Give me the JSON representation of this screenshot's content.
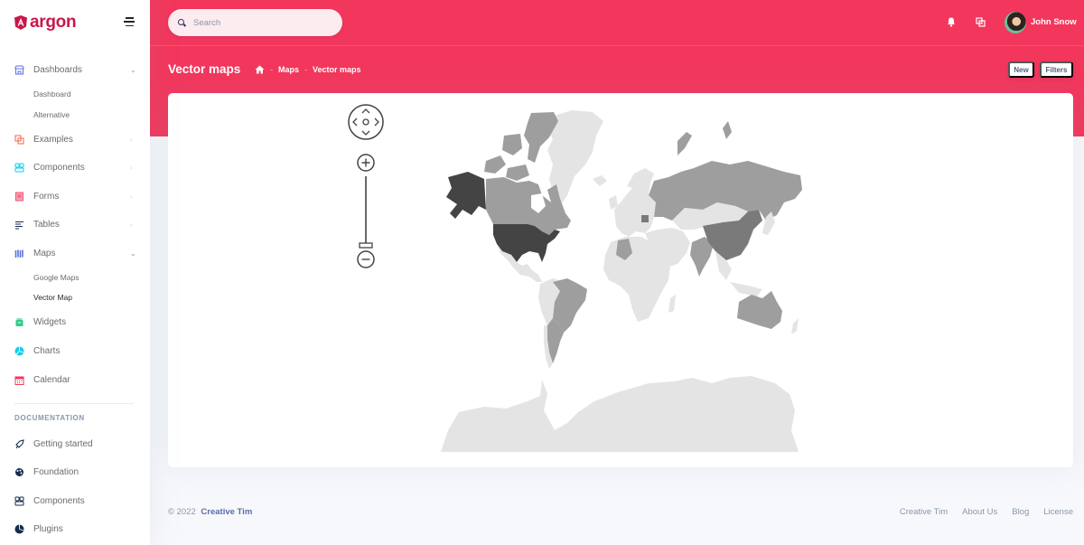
{
  "brand": {
    "name": "argon",
    "logo_icon": "angular-shield-icon"
  },
  "sidebar": {
    "items": [
      {
        "label": "Dashboards",
        "icon": "shop-icon",
        "icon_color": "#5e72e4",
        "expanded": true,
        "children": [
          "Dashboard",
          "Alternative"
        ]
      },
      {
        "label": "Examples",
        "icon": "ungroup-icon",
        "icon_color": "#fb6340",
        "expanded": false
      },
      {
        "label": "Components",
        "icon": "ui-04-icon",
        "icon_color": "#11cdef",
        "expanded": false
      },
      {
        "label": "Forms",
        "icon": "single-copy-icon",
        "icon_color": "#f5365c",
        "expanded": false
      },
      {
        "label": "Tables",
        "icon": "align-left-icon",
        "icon_color": "#172b4d",
        "expanded": false
      },
      {
        "label": "Maps",
        "icon": "map-big-icon",
        "icon_color": "#5e72e4",
        "expanded": true,
        "children": [
          "Google Maps",
          "Vector Map"
        ],
        "active_child": "Vector Map"
      },
      {
        "label": "Widgets",
        "icon": "archive-icon",
        "icon_color": "#2dce89"
      },
      {
        "label": "Charts",
        "icon": "chart-pie-icon",
        "icon_color": "#11cdef"
      },
      {
        "label": "Calendar",
        "icon": "calendar-icon",
        "icon_color": "#f5365c"
      }
    ],
    "documentation": {
      "heading": "DOCUMENTATION",
      "items": [
        {
          "label": "Getting started",
          "icon": "spaceship-icon"
        },
        {
          "label": "Foundation",
          "icon": "palette-icon"
        },
        {
          "label": "Components",
          "icon": "ui-04-icon"
        },
        {
          "label": "Plugins",
          "icon": "chart-pie-icon"
        }
      ]
    }
  },
  "navbar": {
    "search_placeholder": "Search",
    "user_name": "John Snow",
    "icons": [
      "bell-icon",
      "copy-icon"
    ]
  },
  "header": {
    "title": "Vector maps",
    "breadcrumb": [
      "Maps",
      "Vector maps"
    ],
    "buttons": {
      "new": "New",
      "filters": "Filters"
    }
  },
  "map": {
    "controls": {
      "pan": "pan-control",
      "zoom_in": "+",
      "zoom_out": "−"
    },
    "colors": {
      "darkest": "#444444",
      "dark": "#7a7a7a",
      "medium": "#9e9e9e",
      "light": "#e4e4e4"
    },
    "highlighted_regions": [
      {
        "name": "United States",
        "shade": "darkest"
      },
      {
        "name": "China",
        "shade": "dark"
      },
      {
        "name": "Canada",
        "shade": "medium"
      },
      {
        "name": "Russia",
        "shade": "medium"
      },
      {
        "name": "Brazil",
        "shade": "medium"
      },
      {
        "name": "Australia",
        "shade": "medium"
      },
      {
        "name": "India",
        "shade": "medium"
      },
      {
        "name": "Argentina",
        "shade": "medium"
      },
      {
        "name": "Algeria",
        "shade": "medium"
      }
    ]
  },
  "footer": {
    "copyright": "© 2022",
    "company": "Creative Tim",
    "links": [
      "Creative Tim",
      "About Us",
      "Blog",
      "License"
    ]
  },
  "theme": {
    "primary": "#f3365c",
    "brand": "#c9184a"
  }
}
